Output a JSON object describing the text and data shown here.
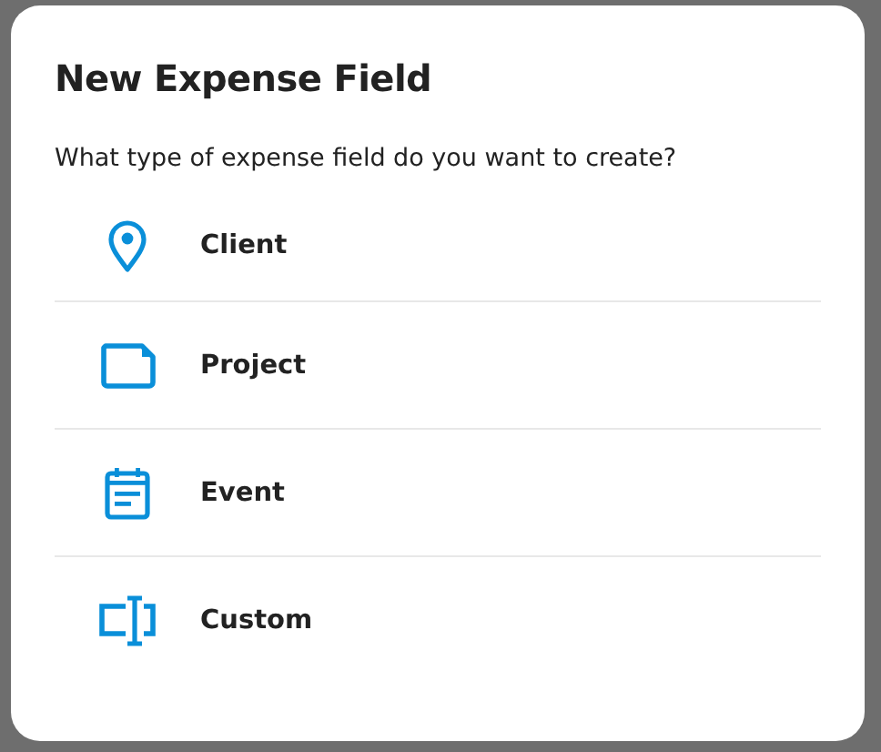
{
  "dialog": {
    "title": "New Expense Field",
    "question": "What type of expense field do you want to create?",
    "options": [
      {
        "kind": "client",
        "label": "Client"
      },
      {
        "kind": "project",
        "label": "Project"
      },
      {
        "kind": "event",
        "label": "Event"
      },
      {
        "kind": "custom",
        "label": "Custom"
      }
    ]
  }
}
